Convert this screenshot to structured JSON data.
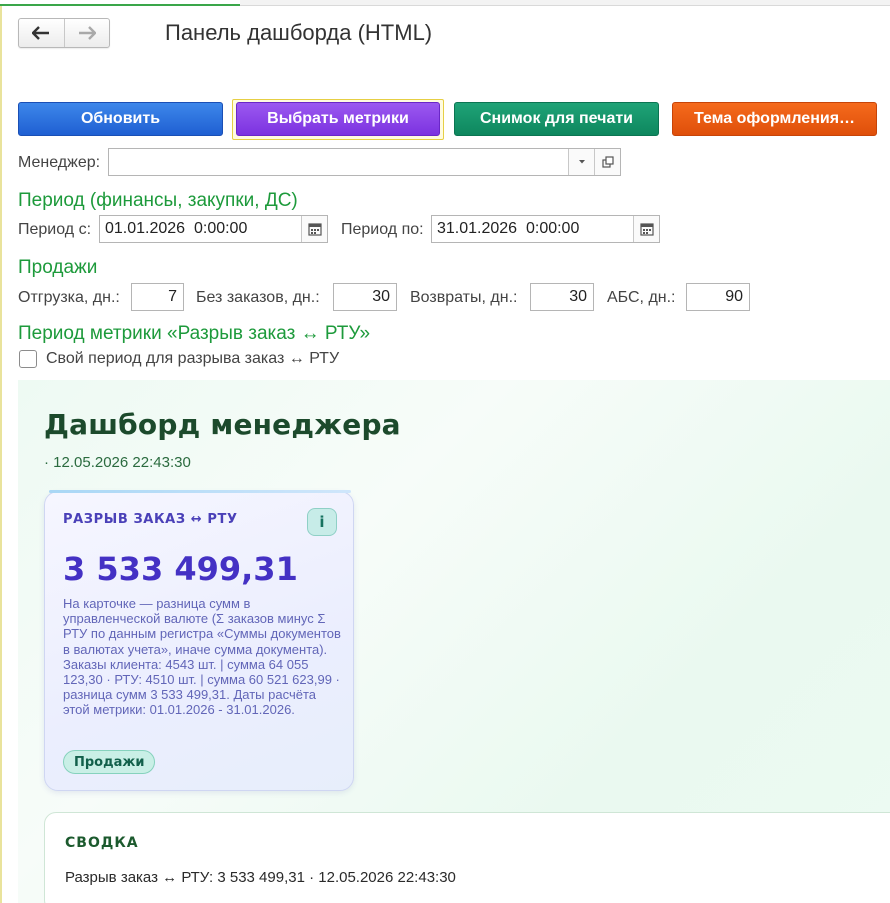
{
  "window": {
    "title": "Панель дашборда (HTML)"
  },
  "toolbar": {
    "refresh_label": "Обновить",
    "metrics_label": "Выбрать метрики",
    "print_label": "Снимок для печати",
    "theme_label": "Тема оформления…"
  },
  "manager": {
    "label": "Менеджер:",
    "value": ""
  },
  "period": {
    "section": "Период (финансы, закупки, ДС)",
    "from_label": "Период с:",
    "from_value": "01.01.2026  0:00:00",
    "to_label": "Период по:",
    "to_value": "31.01.2026  0:00:00"
  },
  "sales": {
    "section": "Продажи",
    "shipment_label": "Отгрузка, дн.:",
    "shipment_value": "7",
    "no_orders_label": "Без заказов, дн.:",
    "no_orders_value": "30",
    "returns_label": "Возвраты, дн.:",
    "returns_value": "30",
    "abc_label": "АБС, дн.:",
    "abc_value": "90"
  },
  "metric_period": {
    "section": "Период метрики «Разрыв заказ ↔ РТУ»",
    "checkbox_label": "Свой период для разрыва заказ ↔ РТУ",
    "checked": false
  },
  "dashboard": {
    "title": "Дашборд менеджера",
    "timestamp": "· 12.05.2026 22:43:30",
    "card": {
      "heading": "РАЗРЫВ ЗАКАЗ ↔ РТУ",
      "info_icon": "i",
      "value": "3 533 499,31",
      "description": "На карточке — разница сумм в управленческой валюте (Σ заказов минус Σ РТУ по данным регистра «Суммы документов в валютах учета», иначе сумма документа). Заказы клиента: 4543 шт. | сумма 64 055 123,30 · РТУ: 4510 шт. | сумма 60 521 623,99 · разница сумм 3 533 499,31. Даты расчёта этой метрики: 01.01.2026 - 31.01.2026.",
      "tag": "Продажи"
    },
    "summary": {
      "heading": "СВОДКА",
      "line": "Разрыв заказ ↔ РТУ: 3 533 499,31 · 12.05.2026 22:43:30"
    }
  },
  "colors": {
    "refresh": "#2a6fdd",
    "metrics": "#8a44e8",
    "print": "#139568",
    "theme": "#e85a12",
    "section_green": "#1d9a3b",
    "card_value": "#4431c4"
  }
}
